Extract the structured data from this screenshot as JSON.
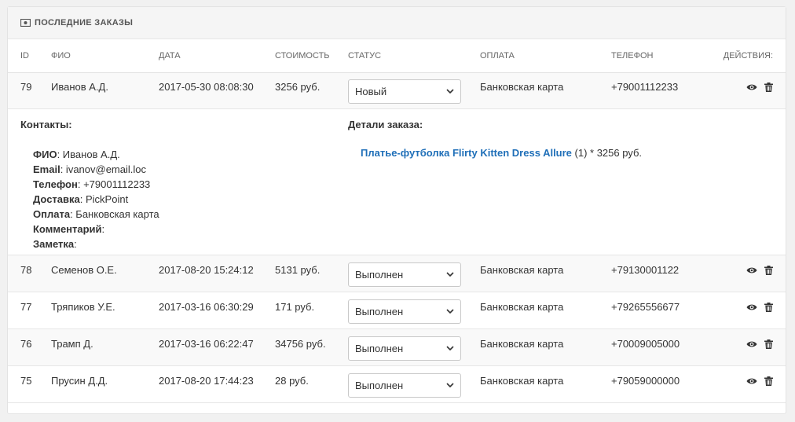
{
  "panel": {
    "title": "ПОСЛЕДНИЕ ЗАКАЗЫ"
  },
  "columns": {
    "id": "ID",
    "name": "ФИО",
    "date": "ДАТА",
    "cost": "СТОИМОСТЬ",
    "status": "СТАТУС",
    "payment": "ОПЛАТА",
    "phone": "ТЕЛЕФОН",
    "actions": "ДЕЙСТВИЯ:"
  },
  "orders": [
    {
      "id": "79",
      "name": "Иванов А.Д.",
      "date": "2017-05-30 08:08:30",
      "cost": "3256 руб.",
      "status": "Новый",
      "payment": "Банковская карта",
      "phone": "+79001112233"
    },
    {
      "id": "78",
      "name": "Семенов О.Е.",
      "date": "2017-08-20 15:24:12",
      "cost": "5131 руб.",
      "status": "Выполнен",
      "payment": "Банковская карта",
      "phone": "+79130001122"
    },
    {
      "id": "77",
      "name": "Тряпиков У.Е.",
      "date": "2017-03-16 06:30:29",
      "cost": "171 руб.",
      "status": "Выполнен",
      "payment": "Банковская карта",
      "phone": "+79265556677"
    },
    {
      "id": "76",
      "name": "Трамп Д.",
      "date": "2017-03-16 06:22:47",
      "cost": "34756 руб.",
      "status": "Выполнен",
      "payment": "Банковская карта",
      "phone": "+70009005000"
    },
    {
      "id": "75",
      "name": "Прусин Д.Д.",
      "date": "2017-08-20 17:44:23",
      "cost": "28 руб.",
      "status": "Выполнен",
      "payment": "Банковская карта",
      "phone": "+79059000000"
    }
  ],
  "details": {
    "contacts_title": "Контакты:",
    "order_title": "Детали заказа:",
    "contacts": [
      {
        "label": "ФИО",
        "value": " Иванов А.Д."
      },
      {
        "label": "Email",
        "value": " ivanov@email.loc"
      },
      {
        "label": "Телефон",
        "value": " +79001112233"
      },
      {
        "label": "Доставка",
        "value": " PickPoint"
      },
      {
        "label": "Оплата",
        "value": " Банковская карта"
      },
      {
        "label": "Комментарий",
        "value": ""
      },
      {
        "label": "Заметка",
        "value": ""
      }
    ],
    "items": [
      {
        "product": "Платье-футболка Flirty Kitten Dress Allure",
        "qty_price": " (1) * 3256 руб."
      }
    ]
  },
  "icons": {
    "panel": "money-icon",
    "view": "eye-icon",
    "delete": "trash-icon",
    "dropdown": "chevron-down-icon"
  },
  "colors": {
    "link": "#1f6fb8",
    "header_bg": "#f5f5f5",
    "row_alt": "#f9f9f9"
  }
}
